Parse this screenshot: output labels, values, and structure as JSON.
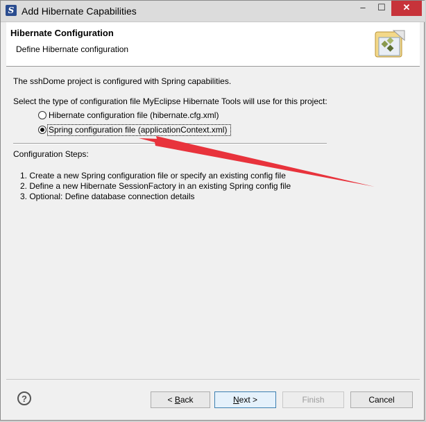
{
  "window": {
    "title": "Add Hibernate Capabilities",
    "minimize_glyph": "–",
    "maximize_glyph": "☐",
    "close_glyph": "✕"
  },
  "header": {
    "title": "Hibernate Configuration",
    "subtitle": "Define Hibernate configuration",
    "banner_icon": "hibernate-wizard-icon"
  },
  "main": {
    "intro": "The sshDome project is configured with Spring capabilities.",
    "prompt": "Select the type of configuration file MyEclipse Hibernate Tools will use for this project:",
    "options": [
      {
        "label": "Hibernate configuration file (hibernate.cfg.xml)",
        "selected": false
      },
      {
        "label": "Spring configuration file (applicationContext.xml)",
        "selected": true
      }
    ],
    "steps_heading": "Configuration Steps:",
    "steps": [
      "1. Create a new Spring configuration file or specify an existing config file",
      "2. Define a new Hibernate SessionFactory in an existing Spring config file",
      "3. Optional: Define database connection details"
    ]
  },
  "annotation": {
    "arrow_color": "#e8333c"
  },
  "footer": {
    "help_glyph": "?",
    "back_label": "< Back",
    "back_mnemonic": "B",
    "next_label": "Next >",
    "next_mnemonic": "N",
    "finish_label": "Finish",
    "cancel_label": "Cancel"
  }
}
